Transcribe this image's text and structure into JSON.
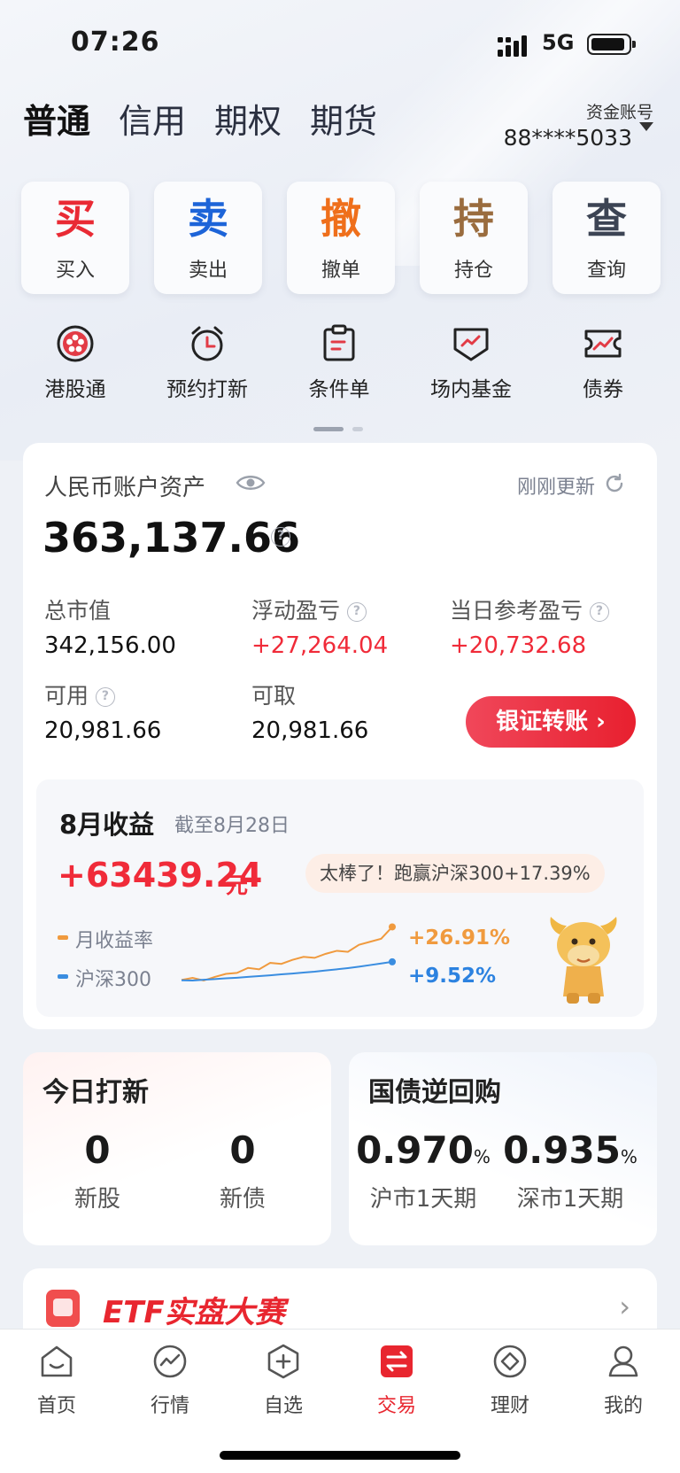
{
  "status_bar": {
    "time": "07:26",
    "network": "5G"
  },
  "account_tabs": [
    {
      "label": "普通"
    },
    {
      "label": "信用"
    },
    {
      "label": "期权"
    },
    {
      "label": "期货"
    }
  ],
  "account": {
    "label": "资金账号",
    "number": "88****5033"
  },
  "quick_actions": [
    {
      "glyph": "买",
      "label": "买入",
      "color": "#e92a34"
    },
    {
      "glyph": "卖",
      "label": "卖出",
      "color": "#1d64d8"
    },
    {
      "glyph": "撤",
      "label": "撤单",
      "color": "#ef6f1b"
    },
    {
      "glyph": "持",
      "label": "持仓",
      "color": "#9a6c3e"
    },
    {
      "glyph": "查",
      "label": "查询",
      "color": "#3c4454"
    }
  ],
  "features": [
    {
      "label": "港股通",
      "icon": "hk-flower-icon"
    },
    {
      "label": "预约打新",
      "icon": "alarm-clock-icon"
    },
    {
      "label": "条件单",
      "icon": "clipboard-icon"
    },
    {
      "label": "场内基金",
      "icon": "fund-shield-icon"
    },
    {
      "label": "债券",
      "icon": "bond-ticket-icon"
    }
  ],
  "assets": {
    "title": "人民币账户资产",
    "updated": "刚刚更新",
    "total": "363,137.66",
    "market_value_label": "总市值",
    "market_value": "342,156.00",
    "floating_pl_label": "浮动盈亏",
    "floating_pl": "+27,264.04",
    "daily_pl_label": "当日参考盈亏",
    "daily_pl": "+20,732.68",
    "available_label": "可用",
    "available": "20,981.66",
    "withdrawable_label": "可取",
    "withdrawable": "20,981.66",
    "transfer_label": "银证转账"
  },
  "monthly": {
    "title": "8月收益",
    "as_of": "截至8月28日",
    "profit": "+63439.24",
    "unit": "元",
    "bubble": "太棒了！跑赢沪深300+17.39%",
    "legend_return": "月收益率",
    "legend_index": "沪深300",
    "return_value": "+26.91%",
    "index_value": "+9.52%",
    "colors": {
      "return": "#f09a3e",
      "index": "#3a8de0"
    }
  },
  "chart_data": {
    "type": "line",
    "x": [
      1,
      2,
      3,
      4,
      5,
      6,
      7,
      8,
      9,
      10,
      11,
      12,
      13,
      14,
      15,
      16,
      17,
      18,
      19,
      20
    ],
    "series": [
      {
        "name": "月收益率",
        "values": [
          0.5,
          1.5,
          0.2,
          2.0,
          3.5,
          4.0,
          6.5,
          5.8,
          9.0,
          8.5,
          10.5,
          12.0,
          11.5,
          13.5,
          15.0,
          14.5,
          18.0,
          19.5,
          21.0,
          26.91
        ]
      },
      {
        "name": "沪深300",
        "values": [
          0.3,
          0.2,
          0.6,
          0.9,
          1.3,
          1.6,
          2.0,
          2.4,
          2.8,
          3.3,
          3.7,
          4.2,
          4.6,
          5.2,
          5.8,
          6.4,
          7.1,
          7.9,
          8.7,
          9.52
        ]
      }
    ],
    "ylim": [
      -2,
      28
    ]
  },
  "ipo": {
    "title": "今日打新",
    "stocks": "0",
    "stocks_label": "新股",
    "bonds": "0",
    "bonds_label": "新债"
  },
  "repo": {
    "title": "国债逆回购",
    "sh_rate": "0.970",
    "sh_label": "沪市1天期",
    "sz_rate": "0.935",
    "sz_label": "深市1天期",
    "pct": "%"
  },
  "etf": {
    "title": "ETF实盘大赛"
  },
  "nav": [
    {
      "label": "首页",
      "icon": "home-icon"
    },
    {
      "label": "行情",
      "icon": "market-icon"
    },
    {
      "label": "自选",
      "icon": "watchlist-icon"
    },
    {
      "label": "交易",
      "icon": "trade-icon",
      "active": true
    },
    {
      "label": "理财",
      "icon": "wealth-icon"
    },
    {
      "label": "我的",
      "icon": "profile-icon"
    }
  ]
}
